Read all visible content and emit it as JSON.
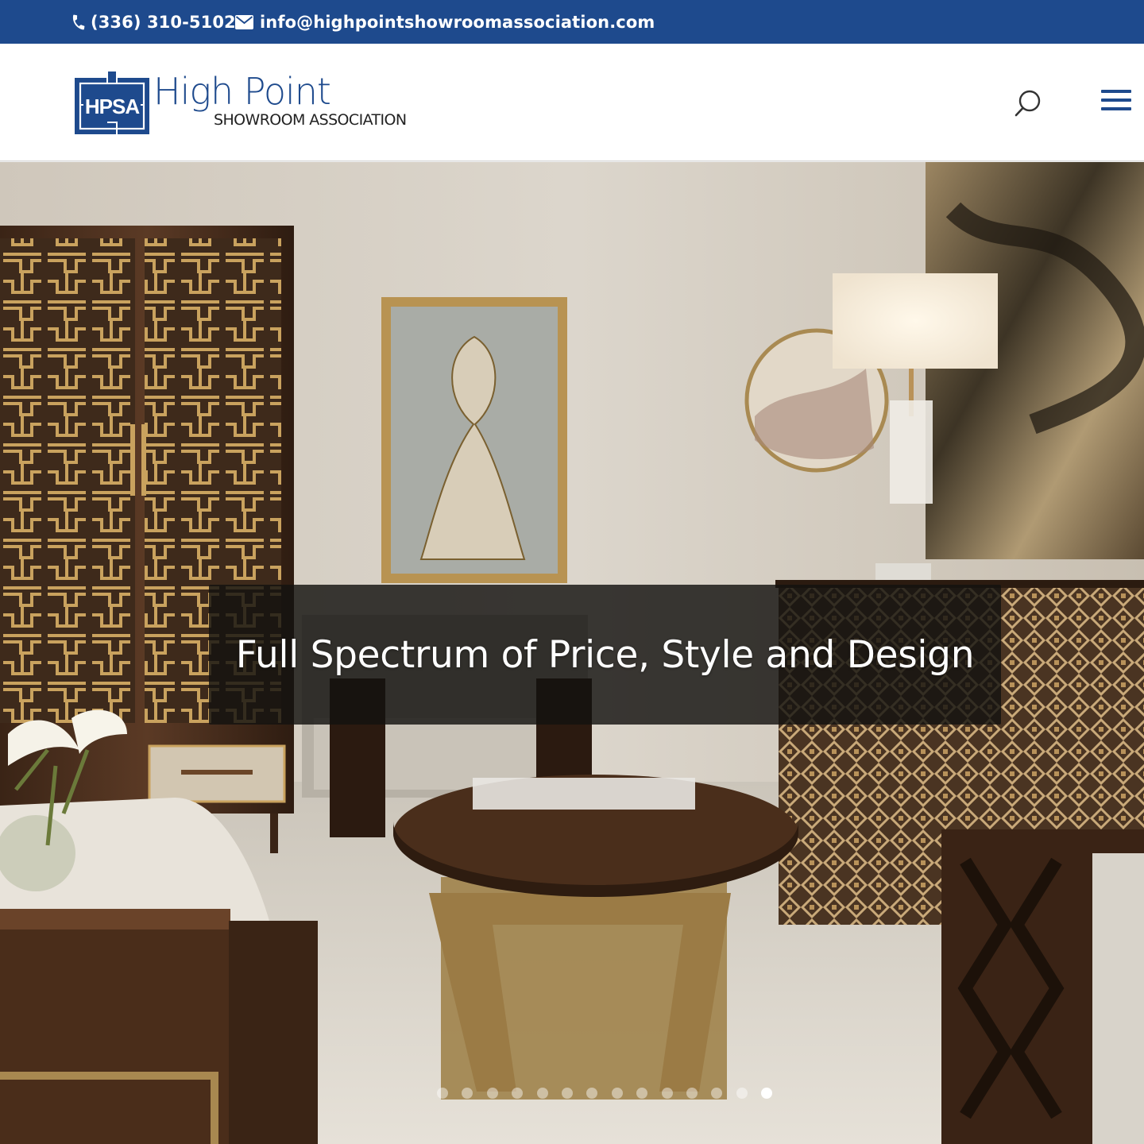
{
  "topbar": {
    "phone": "(336) 310-5102",
    "email": "info@highpointshowroomassociation.com",
    "phone_icon": "phone-icon",
    "email_icon": "envelope-icon"
  },
  "header": {
    "logo_mark": "HPSA",
    "logo_name": "High Point",
    "logo_sub": "SHOWROOM ASSOCIATION",
    "search_icon": "search-icon",
    "menu_icon": "hamburger-menu-icon"
  },
  "hero": {
    "caption": "Full Spectrum of Price, Style and Design",
    "slide_count": 14,
    "active_slide": 14
  },
  "colors": {
    "brand_blue": "#1e4a8d",
    "caption_bg": "#141210",
    "dot_inactive": "#ffffff73",
    "dot_active": "#ffffff"
  }
}
